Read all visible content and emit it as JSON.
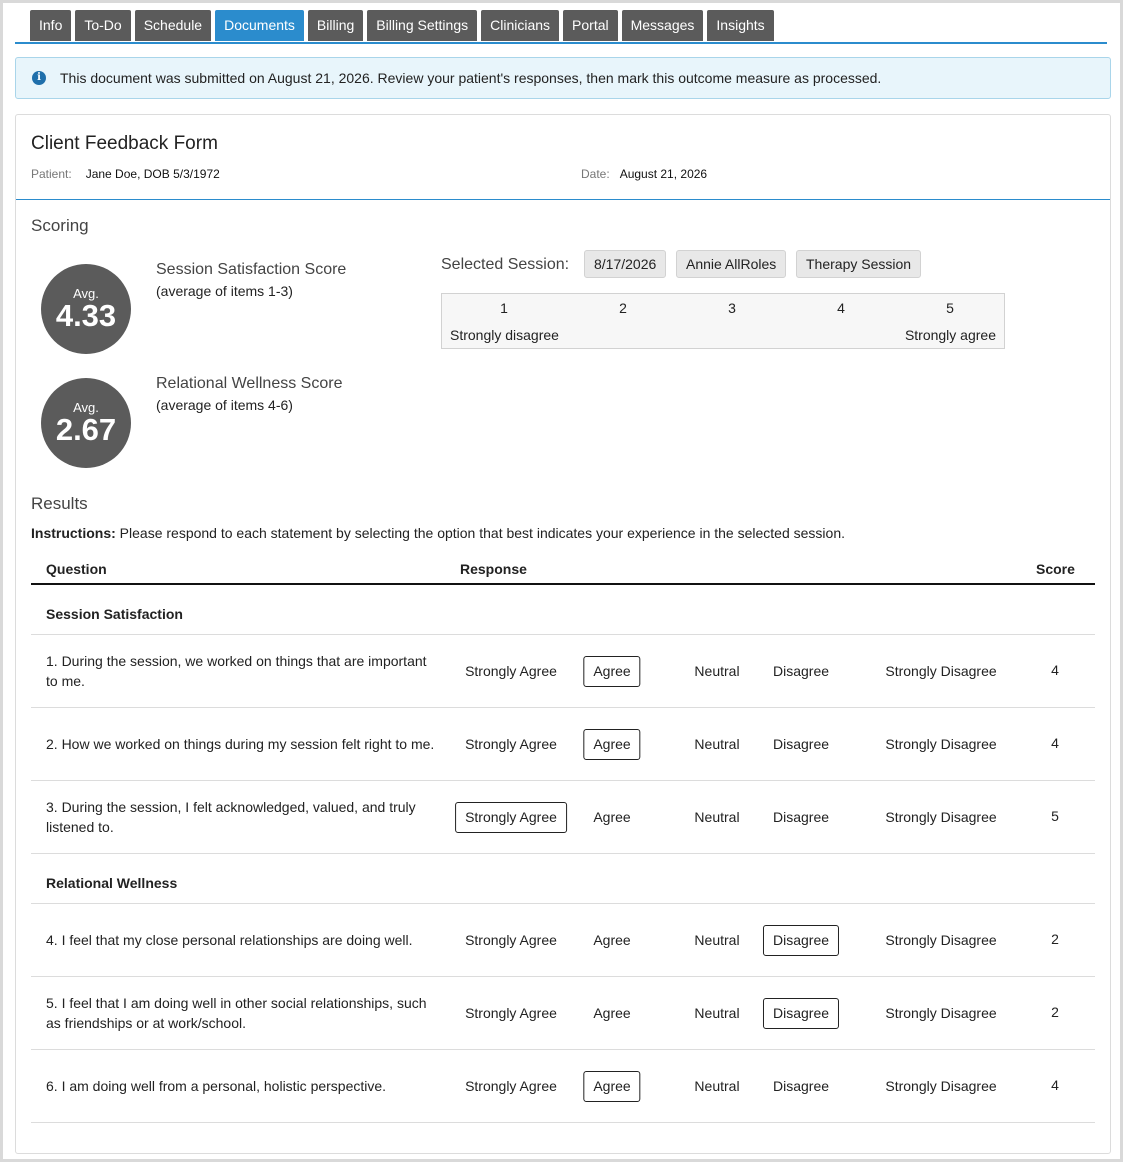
{
  "tabs": [
    {
      "label": "Info"
    },
    {
      "label": "To-Do"
    },
    {
      "label": "Schedule"
    },
    {
      "label": "Documents"
    },
    {
      "label": "Billing"
    },
    {
      "label": "Billing Settings"
    },
    {
      "label": "Clinicians"
    },
    {
      "label": "Portal"
    },
    {
      "label": "Messages"
    },
    {
      "label": "Insights"
    }
  ],
  "active_tab": "Documents",
  "banner": {
    "icon": "info-icon",
    "text": "This document was submitted on August 21, 2026. Review your patient's responses, then mark this outcome measure as processed."
  },
  "form": {
    "title": "Client Feedback Form",
    "patient_label": "Patient:",
    "patient_value": "Jane Doe, DOB 5/3/1972",
    "date_label": "Date:",
    "date_value": "August 21, 2026"
  },
  "scoring": {
    "title": "Scoring",
    "scores": [
      {
        "avg_label": "Avg.",
        "value": "4.33",
        "name": "Session Satisfaction Score",
        "sub": "(average of items 1-3)"
      },
      {
        "avg_label": "Avg.",
        "value": "2.67",
        "name": "Relational Wellness Score",
        "sub": "(average of items 4-6)"
      }
    ],
    "selected_session_label": "Selected Session:",
    "session_chips": [
      "8/17/2026",
      "Annie AllRoles",
      "Therapy Session"
    ],
    "scale": {
      "numbers": [
        "1",
        "2",
        "3",
        "4",
        "5"
      ],
      "low_label": "Strongly disagree",
      "high_label": "Strongly agree"
    }
  },
  "results": {
    "title": "Results",
    "instructions_label": "Instructions:",
    "instructions_text": " Please respond to each statement by selecting the option that best indicates your experience in the selected session.",
    "headers": {
      "question": "Question",
      "response": "Response",
      "score": "Score"
    },
    "options": [
      "Strongly Agree",
      "Agree",
      "Neutral",
      "Disagree",
      "Strongly Disagree"
    ],
    "groups": [
      {
        "name": "Session Satisfaction",
        "questions": [
          {
            "text": "1. During the session, we worked on things that are important to me.",
            "selected": "Agree",
            "score": "4"
          },
          {
            "text": "2. How we worked on things during my session felt right to me.",
            "selected": "Agree",
            "score": "4"
          },
          {
            "text": "3. During the session, I felt acknowledged, valued, and truly listened to.",
            "selected": "Strongly Agree",
            "score": "5"
          }
        ]
      },
      {
        "name": "Relational Wellness",
        "questions": [
          {
            "text": "4. I feel that my close personal relationships are doing well.",
            "selected": "Disagree",
            "score": "2"
          },
          {
            "text": "5. I feel that I am doing well in other social relationships, such as friendships or at work/school.",
            "selected": "Disagree",
            "score": "2"
          },
          {
            "text": "6. I am doing well from a personal, holistic perspective.",
            "selected": "Agree",
            "score": "4"
          }
        ]
      }
    ]
  }
}
